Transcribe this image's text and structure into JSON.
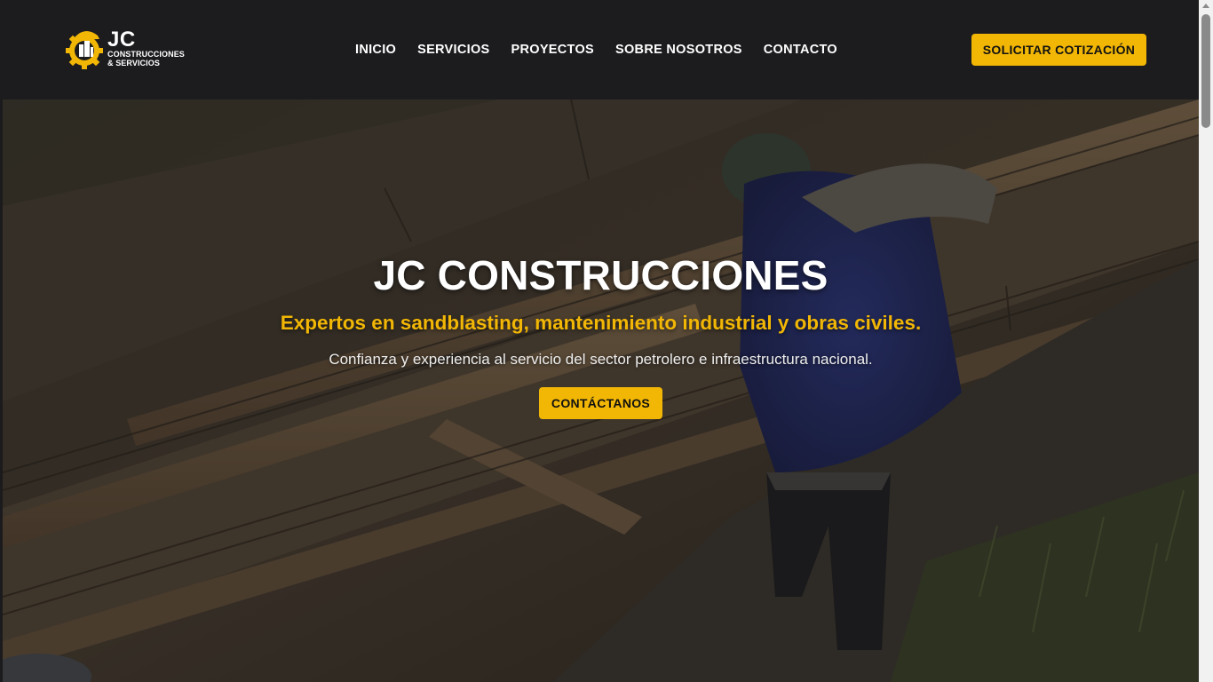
{
  "header": {
    "logo": {
      "name": "JC",
      "tagline_line1": "CONSTRUCCIONES",
      "tagline_line2": "& SERVICIOS",
      "icon": "gear-hardhat-building-icon"
    },
    "nav": [
      {
        "label": "INICIO"
      },
      {
        "label": "SERVICIOS"
      },
      {
        "label": "PROYECTOS"
      },
      {
        "label": "SOBRE NOSOTROS"
      },
      {
        "label": "CONTACTO"
      }
    ],
    "cta_label": "SOLICITAR COTIZACIÓN"
  },
  "hero": {
    "title": "JC CONSTRUCCIONES",
    "subtitle": "Expertos en sandblasting, mantenimiento industrial y obras civiles.",
    "text": "Confianza y experiencia al servicio del sector petrolero e infraestructura nacional.",
    "button_label": "CONTÁCTANOS"
  },
  "colors": {
    "accent": "#f2b705",
    "header_bg": "#1c1c1f",
    "text_light": "#ffffff"
  }
}
